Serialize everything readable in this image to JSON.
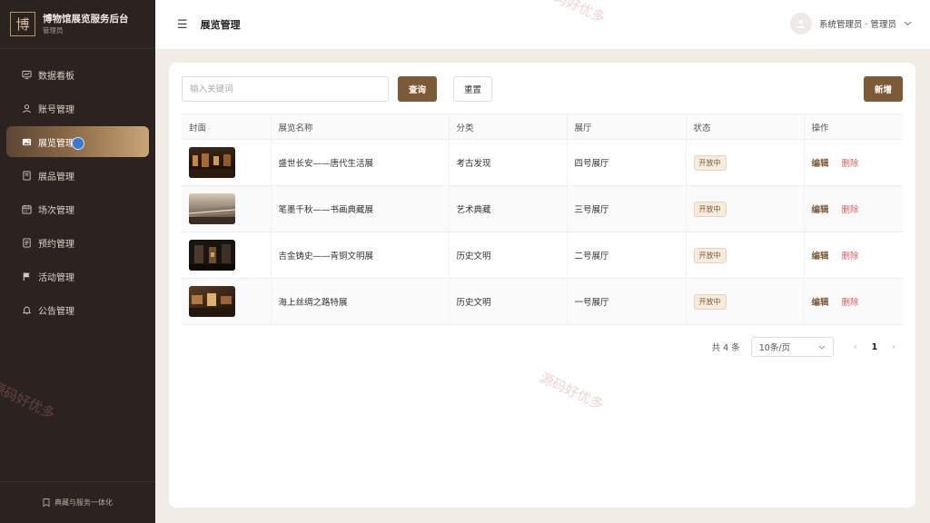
{
  "brand": {
    "logo_char": "博",
    "title": "博物馆展览服务后台",
    "subtitle": "管理员"
  },
  "sidebar": {
    "items": [
      {
        "label": "数据看板",
        "icon": "dashboard-icon"
      },
      {
        "label": "账号管理",
        "icon": "user-icon"
      },
      {
        "label": "展览管理",
        "icon": "image-icon",
        "active": true
      },
      {
        "label": "展品管理",
        "icon": "book-icon"
      },
      {
        "label": "场次管理",
        "icon": "calendar-icon"
      },
      {
        "label": "预约管理",
        "icon": "document-icon"
      },
      {
        "label": "活动管理",
        "icon": "flag-icon"
      },
      {
        "label": "公告管理",
        "icon": "bell-icon"
      }
    ],
    "footer": "典藏与服务一体化"
  },
  "header": {
    "menu_icon": "☰",
    "title": "展览管理",
    "user_label": "系统管理员 · 管理员"
  },
  "toolbar": {
    "search_placeholder": "输入关键词",
    "search_value": "",
    "query_label": "查询",
    "reset_label": "重置",
    "add_label": "新增"
  },
  "table": {
    "columns": [
      "封面",
      "展览名称",
      "分类",
      "展厅",
      "状态",
      "操作"
    ],
    "rows": [
      {
        "name": "盛世长安——唐代生活展",
        "category": "考古发现",
        "hall": "四号展厅",
        "status": "开放中",
        "edit": "编辑",
        "delete": "删除"
      },
      {
        "name": "笔墨千秋——书画典藏展",
        "category": "艺术典藏",
        "hall": "三号展厅",
        "status": "开放中",
        "edit": "编辑",
        "delete": "删除"
      },
      {
        "name": "吉金铸史——青铜文明展",
        "category": "历史文明",
        "hall": "二号展厅",
        "status": "开放中",
        "edit": "编辑",
        "delete": "删除"
      },
      {
        "name": "海上丝绸之路特展",
        "category": "历史文明",
        "hall": "一号展厅",
        "status": "开放中",
        "edit": "编辑",
        "delete": "删除"
      }
    ]
  },
  "pagination": {
    "total_text": "共 4 条",
    "page_size": "10条/页",
    "current_page": "1",
    "prev": "‹",
    "next": "›"
  },
  "watermark": "源码好优多",
  "colors": {
    "sidebar_bg": "#2a231f",
    "accent": "#7c5a35",
    "danger": "#e05b5b",
    "page_bg": "#f1ece6"
  }
}
